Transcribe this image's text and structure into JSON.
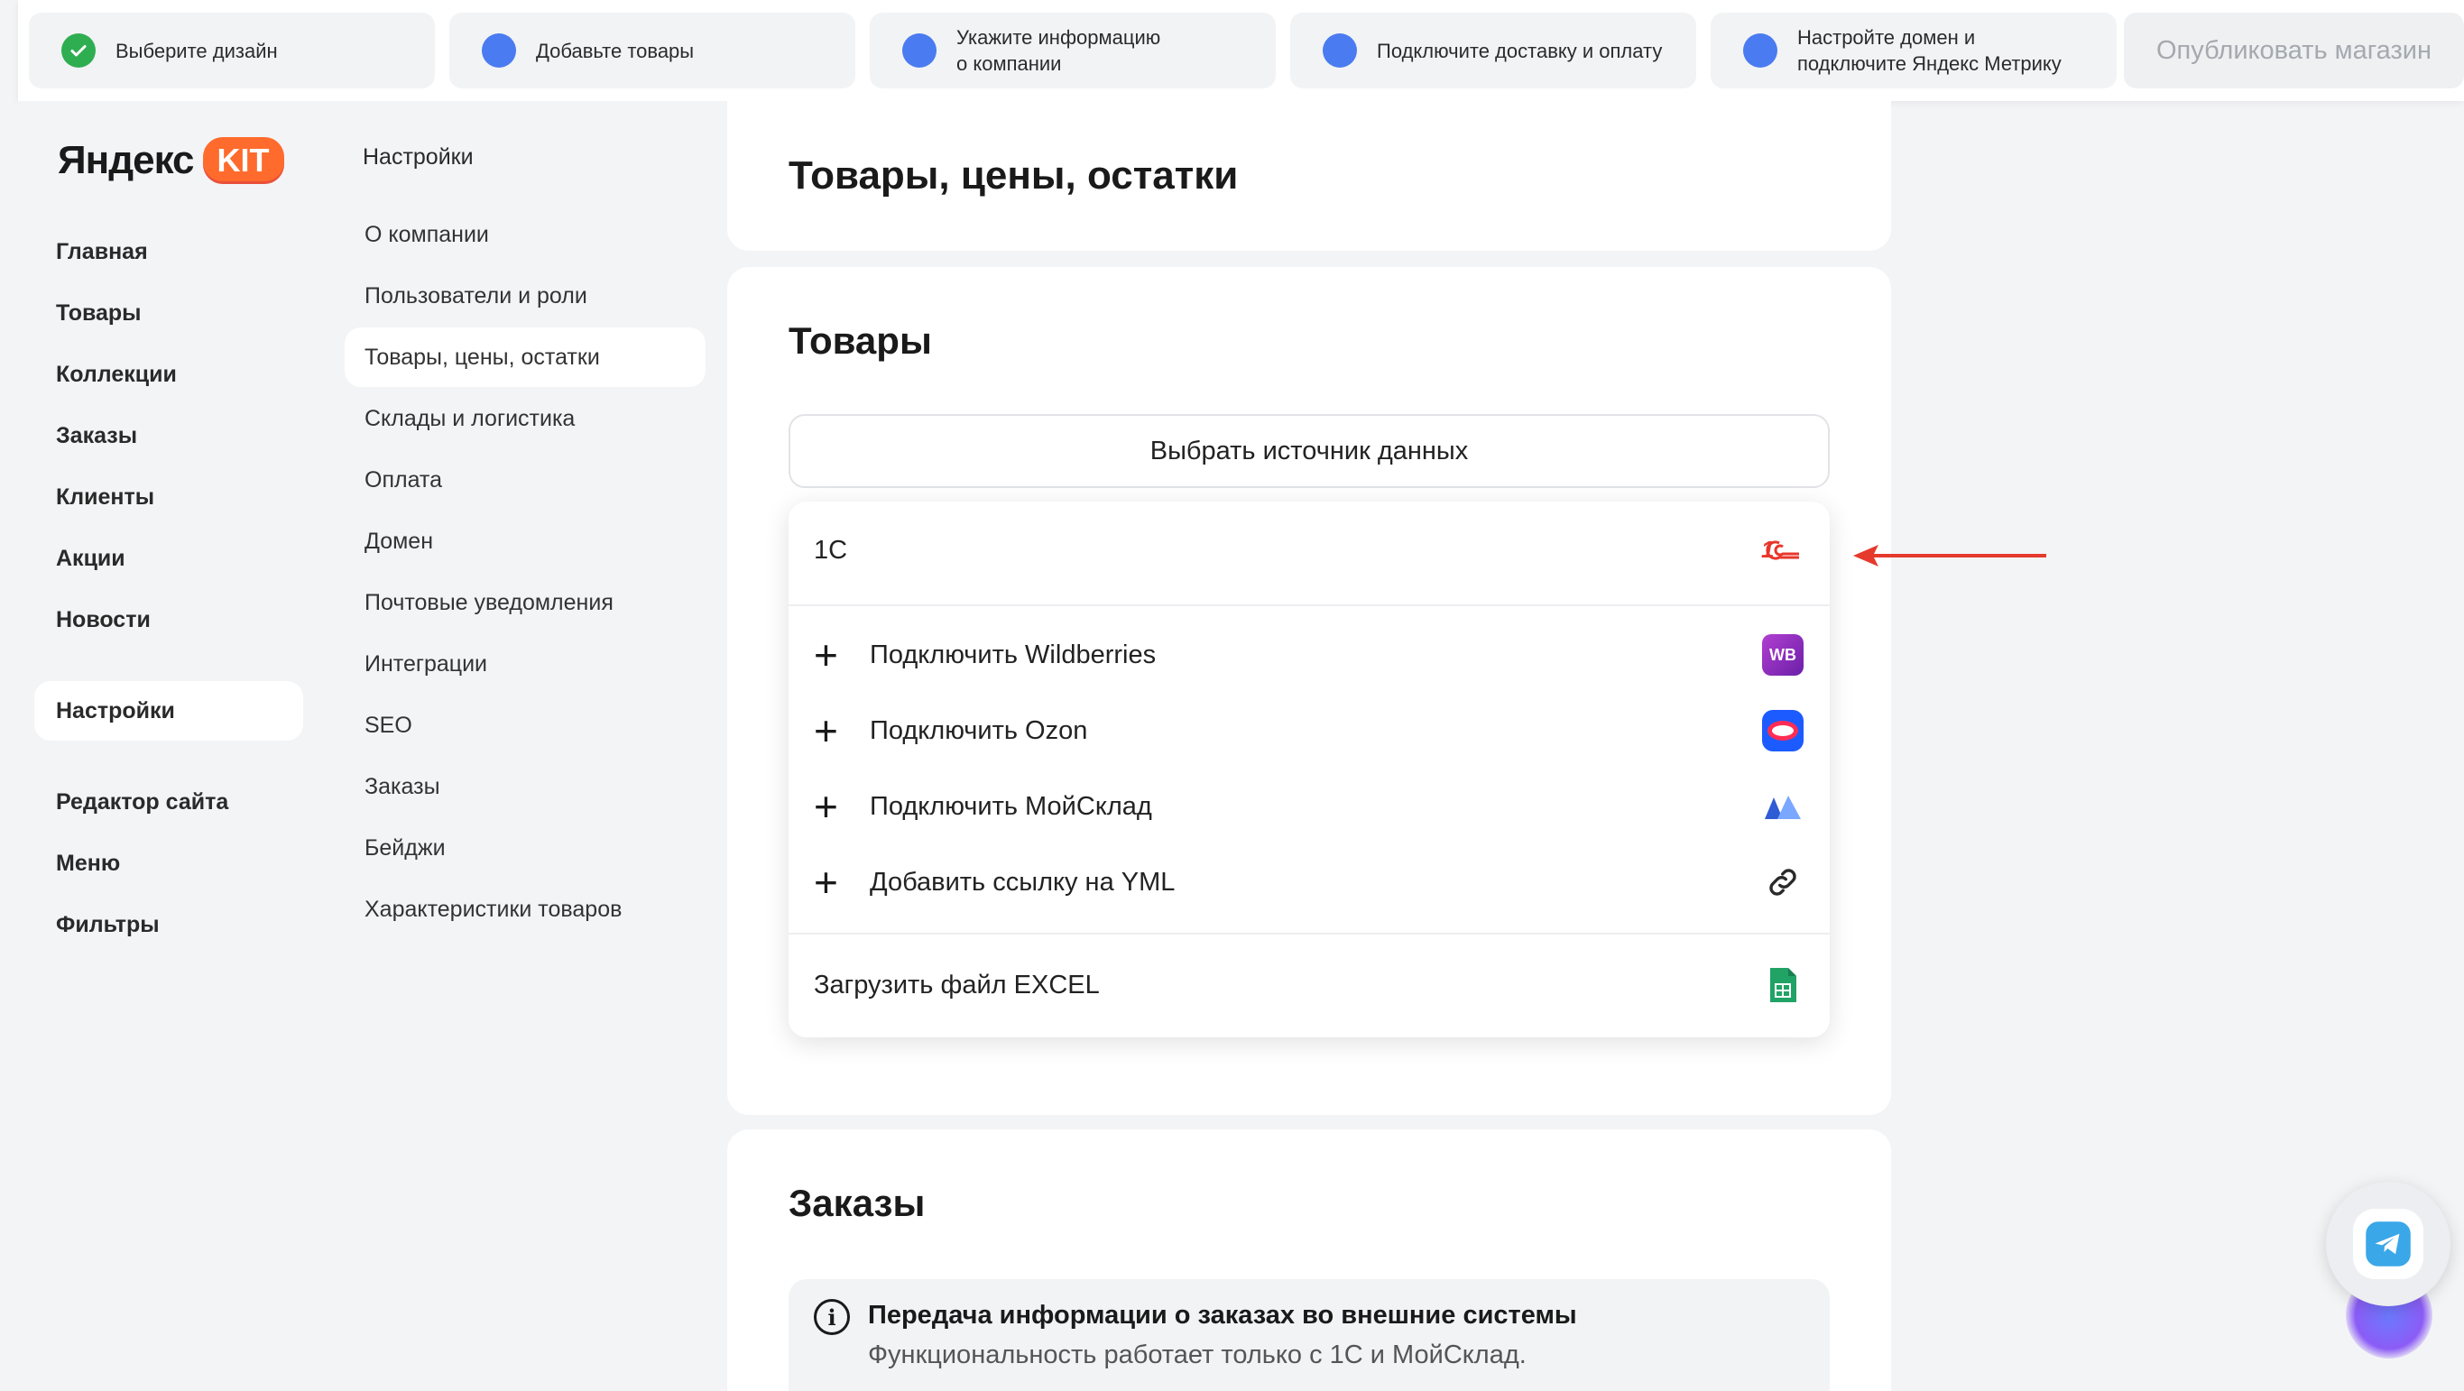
{
  "onboarding": {
    "steps": [
      {
        "label": "Выберите дизайн",
        "done": true
      },
      {
        "label": "Добавьте товары",
        "done": false
      },
      {
        "label": "Укажите информацию\nо компании",
        "done": false
      },
      {
        "label": "Подключите доставку и оплату",
        "done": false
      },
      {
        "label": "Настройте домен и\nподключите Яндекс Метрику",
        "done": false
      }
    ],
    "publish_label": "Опубликовать магазин"
  },
  "logo": {
    "text": "Яндекс",
    "badge": "KIT"
  },
  "nav": {
    "items": [
      "Главная",
      "Товары",
      "Коллекции",
      "Заказы",
      "Клиенты",
      "Акции",
      "Новости"
    ],
    "settings": "Настройки",
    "bottom_items": [
      "Редактор сайта",
      "Меню",
      "Фильтры"
    ]
  },
  "subnav": {
    "title": "Настройки",
    "items": [
      "О компании",
      "Пользователи и роли",
      "Товары, цены, остатки",
      "Склады и логистика",
      "Оплата",
      "Домен",
      "Почтовые уведомления",
      "Интеграции",
      "SEO",
      "Заказы",
      "Бейджи",
      "Характеристики товаров"
    ],
    "active_index": 2
  },
  "content": {
    "page_title": "Товары, цены, остатки",
    "products_title": "Товары",
    "source_button": "Выбрать источник данных",
    "dropdown": {
      "first": {
        "label": "1С",
        "icon": "1c-logo-icon"
      },
      "connect": [
        {
          "label": "Подключить Wildberries",
          "icon": "wildberries-icon",
          "badge": "WB"
        },
        {
          "label": "Подключить Ozon",
          "icon": "ozon-icon"
        },
        {
          "label": "Подключить МойСклад",
          "icon": "moysklad-icon"
        },
        {
          "label": "Добавить ссылку на YML",
          "icon": "link-icon"
        }
      ],
      "excel": {
        "label": "Загрузить файл EXCEL",
        "icon": "excel-file-icon"
      }
    },
    "orders_title": "Заказы",
    "info": {
      "title": "Передача информации о заказах во внешние системы",
      "text": "Функциональность работает только с 1С и МойСклад."
    }
  },
  "colors": {
    "accent_blue": "#4a7bf0",
    "done_green": "#2fae51",
    "arrow_red": "#e53a2c",
    "logo_orange": "#ff6b2c"
  }
}
